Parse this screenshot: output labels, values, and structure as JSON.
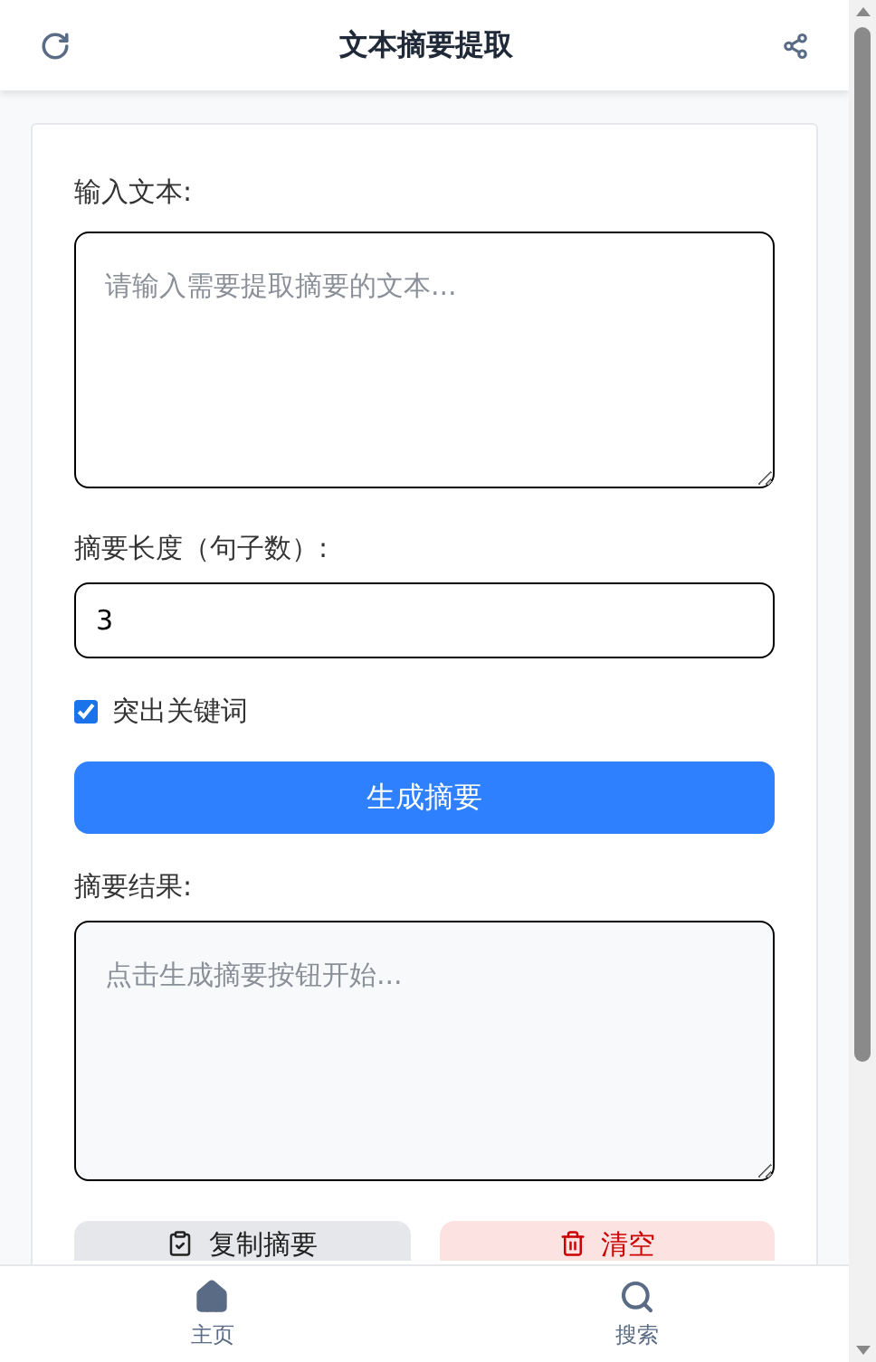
{
  "header": {
    "title": "文本摘要提取"
  },
  "input": {
    "label": "输入文本:",
    "placeholder": "请输入需要提取摘要的文本..."
  },
  "length": {
    "label": "摘要长度（句子数）:",
    "value": "3"
  },
  "highlight": {
    "label": "突出关键词",
    "checked": true
  },
  "generate_button": "生成摘要",
  "result": {
    "label": "摘要结果:",
    "placeholder": "点击生成摘要按钮开始..."
  },
  "actions": [
    {
      "label": "复制摘要",
      "kind": "copy"
    },
    {
      "label": "清空",
      "kind": "clear"
    }
  ],
  "bottom_nav": [
    {
      "label": "主页",
      "kind": "home"
    },
    {
      "label": "搜索",
      "kind": "search"
    }
  ]
}
